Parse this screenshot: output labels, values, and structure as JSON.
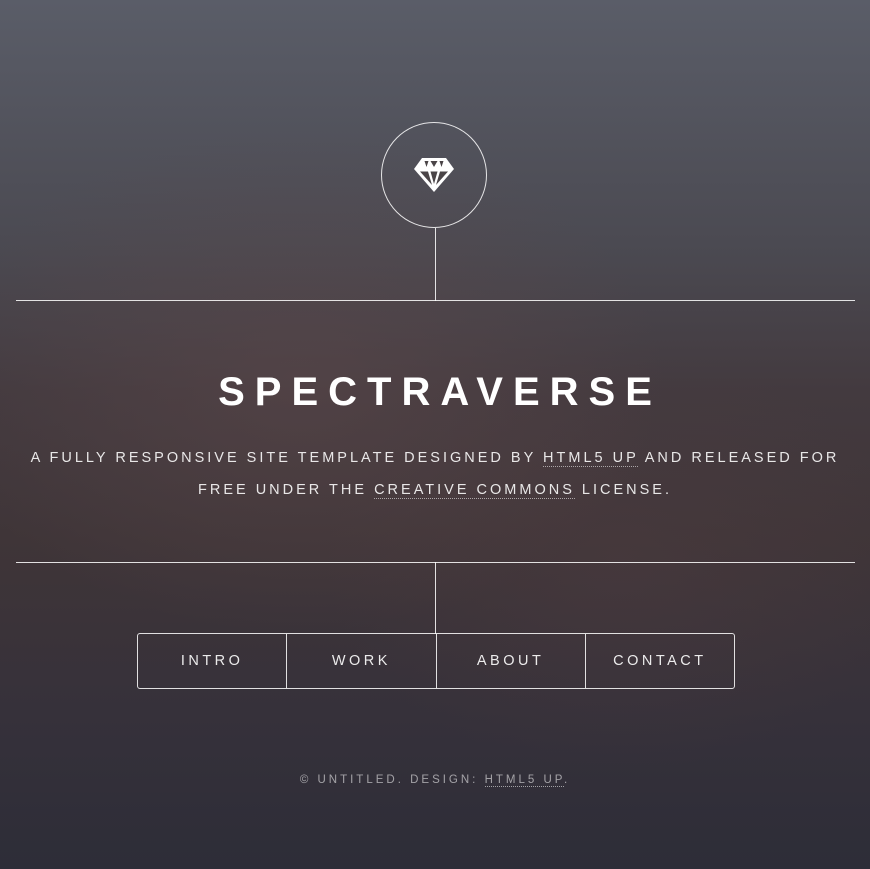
{
  "header": {
    "logo_icon": "diamond-icon"
  },
  "banner": {
    "title": "SPECTRAVERSE",
    "description": {
      "part1": "A fully responsive site template designed by ",
      "link1": "HTML5 UP",
      "part2": " and released for free under the ",
      "link2": "Creative Commons",
      "part3": " license."
    }
  },
  "nav": {
    "items": [
      {
        "label": "INTRO"
      },
      {
        "label": "WORK"
      },
      {
        "label": "ABOUT"
      },
      {
        "label": "CONTACT"
      }
    ]
  },
  "footer": {
    "copyright": "© Untitled. Design: ",
    "design_link": "HTML5 UP",
    "end": "."
  }
}
